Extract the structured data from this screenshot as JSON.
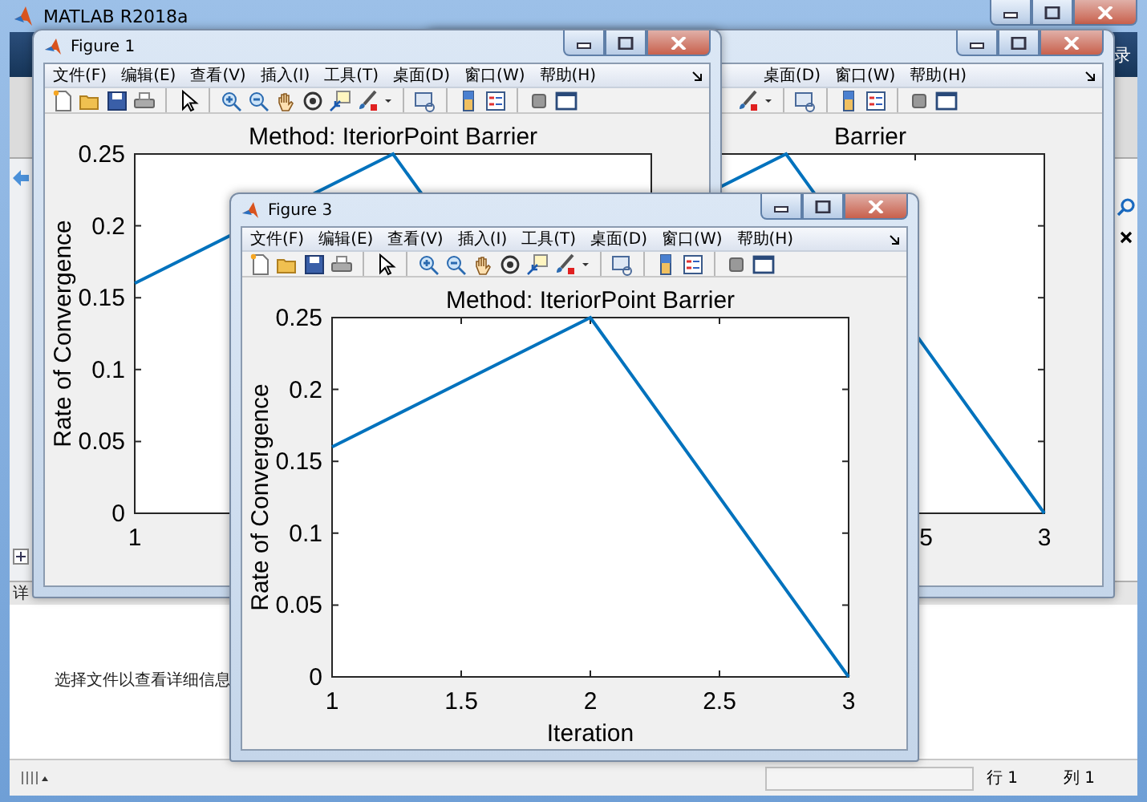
{
  "app": {
    "title": "MATLAB R2018a",
    "ribbon_label": "录",
    "details_label": "详",
    "details_message": "选择文件以查看详细信息",
    "status": {
      "row": "行 1",
      "column": "列 1"
    }
  },
  "figures": [
    {
      "kind": "covered",
      "menu": [
        "桌面(D)",
        "窗口(W)",
        "帮助(H)"
      ],
      "plot": {
        "title": "Barrier",
        "xtick_labels": [
          "5",
          "3"
        ]
      }
    },
    {
      "kind": "full",
      "title": "Figure 1",
      "menu": [
        "文件(F)",
        "编辑(E)",
        "查看(V)",
        "插入(I)",
        "工具(T)",
        "桌面(D)",
        "窗口(W)",
        "帮助(H)"
      ],
      "plot": {
        "title": "Method: IteriorPoint Barrier",
        "ylabel": "Rate of Convergence",
        "ytick_labels": [
          "0.25",
          "0.2",
          "0.15",
          "0.1",
          "0.05",
          "0"
        ],
        "xtick_labels": [
          "1"
        ]
      }
    },
    {
      "kind": "full",
      "title": "Figure 3",
      "menu": [
        "文件(F)",
        "编辑(E)",
        "查看(V)",
        "插入(I)",
        "工具(T)",
        "桌面(D)",
        "窗口(W)",
        "帮助(H)"
      ],
      "plot": {
        "chart_data": {
          "type": "line",
          "title": "Method: IteriorPoint Barrier",
          "xlabel": "Iteration",
          "ylabel": "Rate of Convergence",
          "x": [
            1,
            2,
            3
          ],
          "series": [
            {
              "color": "#0072bd",
              "values": [
                0.16,
                0.25,
                0
              ]
            }
          ],
          "xlim": [
            1,
            3
          ],
          "ylim": [
            0,
            0.25
          ],
          "xticks": [
            1,
            1.5,
            2,
            2.5,
            3
          ],
          "yticks": [
            0,
            0.05,
            0.1,
            0.15,
            0.2,
            0.25
          ]
        }
      }
    }
  ]
}
